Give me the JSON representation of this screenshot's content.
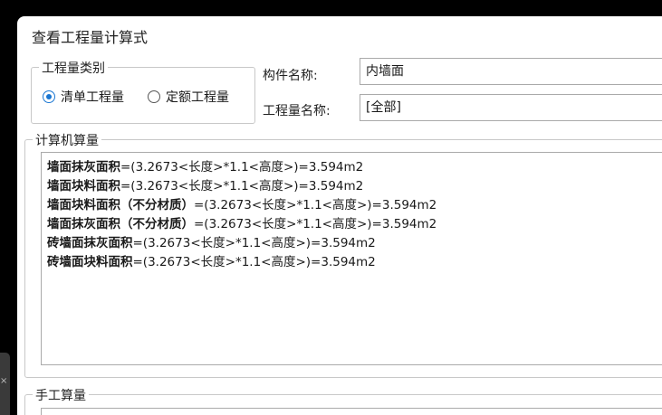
{
  "dialog": {
    "title": "查看工程量计算式"
  },
  "category_group": {
    "legend": "工程量类别",
    "options": [
      {
        "label": "清单工程量",
        "checked": true
      },
      {
        "label": "定额工程量",
        "checked": false
      }
    ]
  },
  "component": {
    "label": "构件名称:",
    "value": "内墙面"
  },
  "quantity": {
    "label": "工程量名称:",
    "value": "[全部]"
  },
  "computer_group": {
    "legend": "计算机算量",
    "lines": [
      {
        "name": "墙面抹灰面积",
        "formula": "=(3.2673<长度>*1.1<高度>)=3.594m2"
      },
      {
        "name": "墙面块料面积",
        "formula": "=(3.2673<长度>*1.1<高度>)=3.594m2"
      },
      {
        "name": "墙面块料面积（不分材质）",
        "formula": "=(3.2673<长度>*1.1<高度>)=3.594m2"
      },
      {
        "name": "墙面抹灰面积（不分材质）",
        "formula": "=(3.2673<长度>*1.1<高度>)=3.594m2"
      },
      {
        "name": "砖墙面抹灰面积",
        "formula": "=(3.2673<长度>*1.1<高度>)=3.594m2"
      },
      {
        "name": "砖墙面块料面积",
        "formula": "=(3.2673<长度>*1.1<高度>)=3.594m2"
      }
    ]
  },
  "manual_group": {
    "legend": "手工算量"
  },
  "side_tab": {
    "glyph": "×"
  },
  "colors": {
    "accent": "#1976d2",
    "border": "#c8c8c8",
    "background": "#ffffff"
  }
}
